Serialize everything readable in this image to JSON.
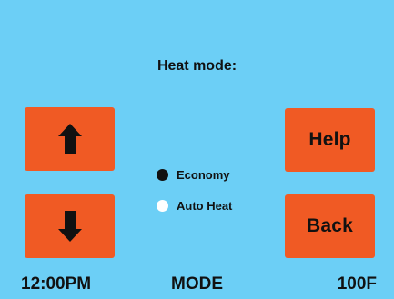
{
  "screen": {
    "title": "Heat mode:",
    "background_color": "#6ccff6",
    "button_color": "#f05a24"
  },
  "buttons": {
    "up_icon": "arrow-up-icon",
    "down_icon": "arrow-down-icon",
    "help_label": "Help",
    "back_label": "Back"
  },
  "options": [
    {
      "label": "Economy",
      "selected": true
    },
    {
      "label": "Auto Heat",
      "selected": false
    }
  ],
  "status_bar": {
    "time": "12:00PM",
    "mode": "MODE",
    "temperature": "100F"
  }
}
